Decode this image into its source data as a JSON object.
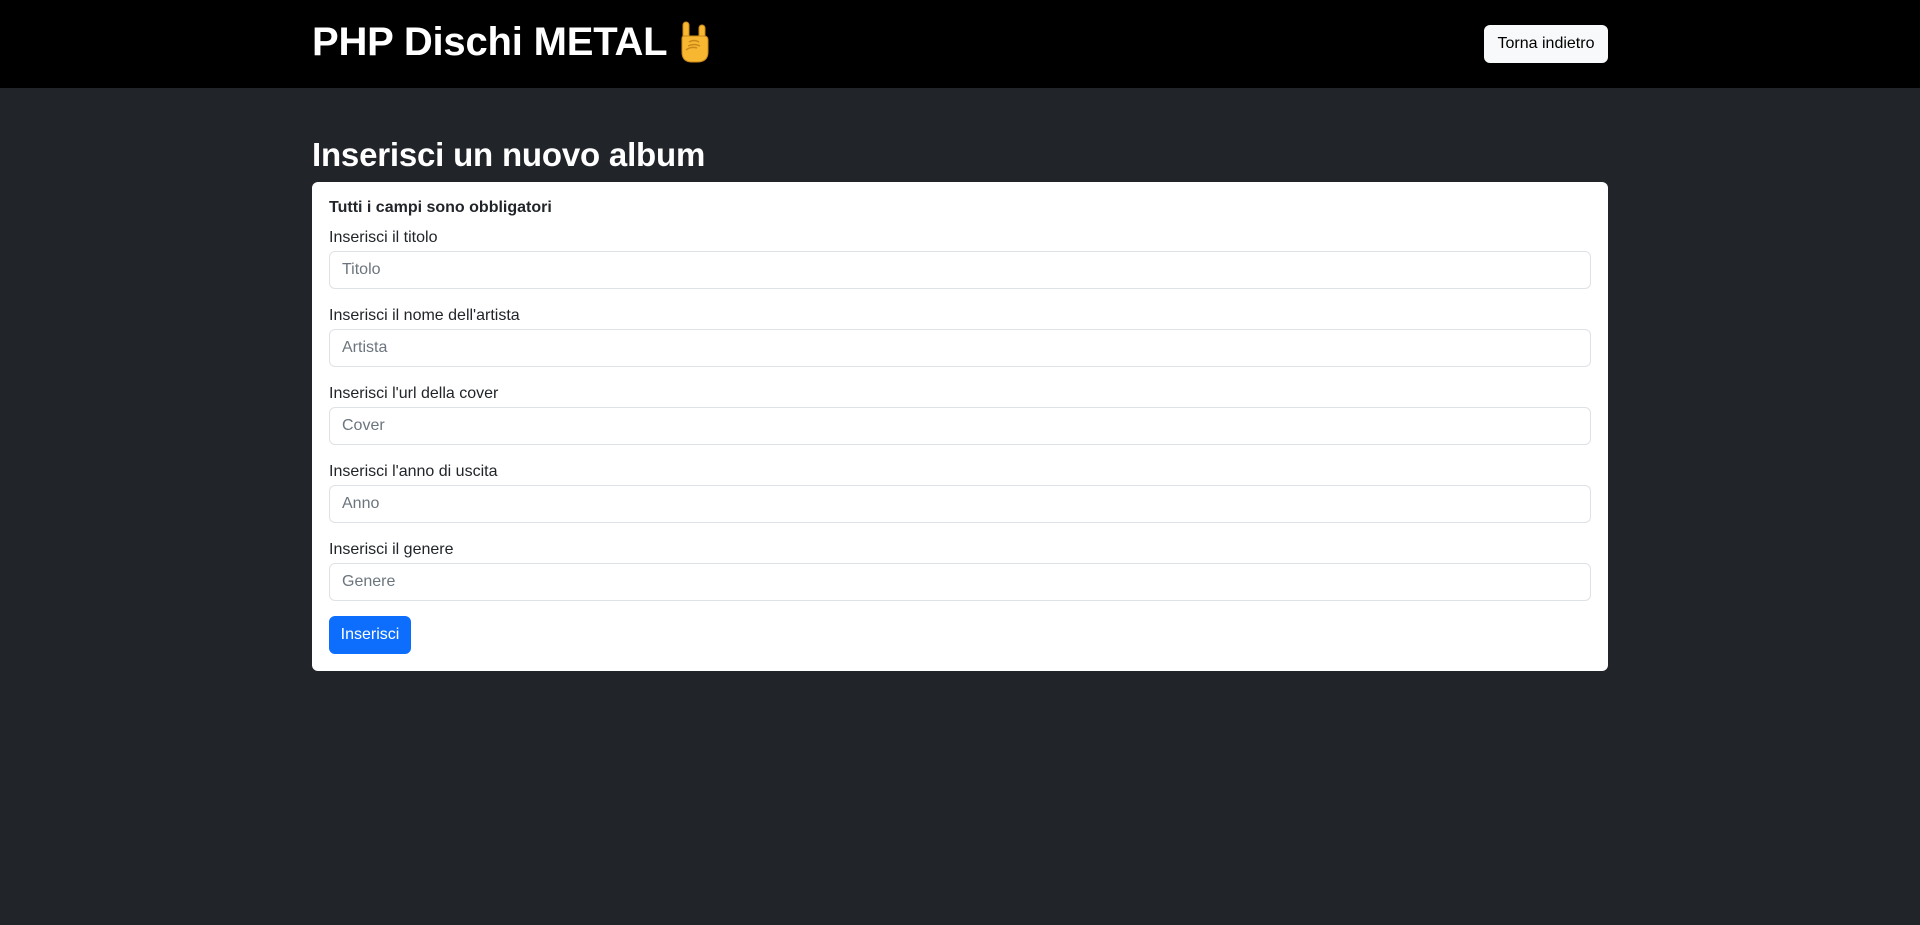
{
  "header": {
    "brand_title": "PHP Dischi METAL",
    "brand_emoji_icon": "rock-on-hand-icon",
    "back_button_label": "Torna indietro"
  },
  "main": {
    "page_title": "Inserisci un nuovo album",
    "form": {
      "required_note": "Tutti i campi sono obbligatori",
      "fields": [
        {
          "label": "Inserisci il titolo",
          "placeholder": "Titolo",
          "value": ""
        },
        {
          "label": "Inserisci il nome dell'artista",
          "placeholder": "Artista",
          "value": ""
        },
        {
          "label": "Inserisci l'url della cover",
          "placeholder": "Cover",
          "value": ""
        },
        {
          "label": "Inserisci l'anno di uscita",
          "placeholder": "Anno",
          "value": ""
        },
        {
          "label": "Inserisci il genere",
          "placeholder": "Genere",
          "value": ""
        }
      ],
      "submit_label": "Inserisci"
    }
  },
  "colors": {
    "header_background": "#000000",
    "page_background": "#212529",
    "primary_button": "#0d6efd",
    "light_button": "#f8f9fa",
    "emoji_skin": "#f7b731"
  }
}
